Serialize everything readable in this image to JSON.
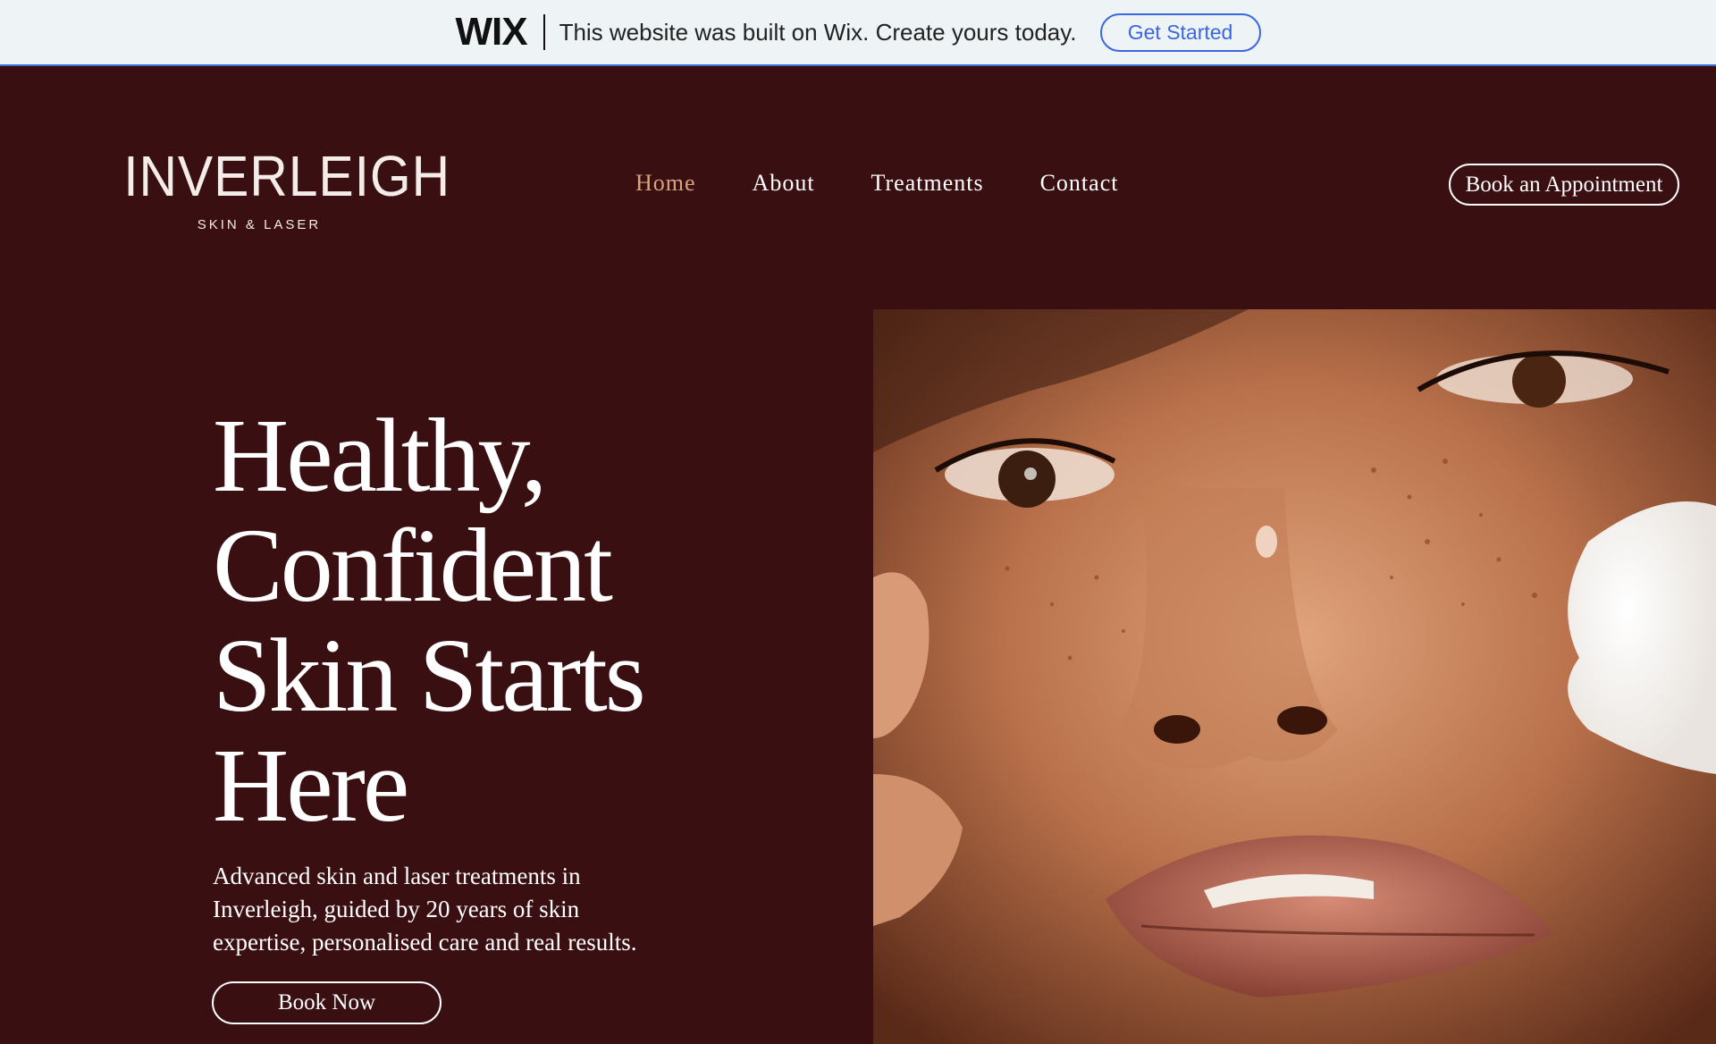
{
  "wix_banner": {
    "logo": "WIX",
    "message": "This website was built on Wix. Create yours today.",
    "cta_label": "Get Started",
    "accent_color": "#3a66e0"
  },
  "header": {
    "logo_main": "INVERLEIGH",
    "logo_sub": "SKIN & LASER",
    "nav": [
      {
        "label": "Home",
        "active": true
      },
      {
        "label": "About",
        "active": false
      },
      {
        "label": "Treatments",
        "active": false
      },
      {
        "label": "Contact",
        "active": false
      }
    ],
    "cta_label": "Book an Appointment",
    "active_color": "#d6a57e"
  },
  "hero": {
    "title_lines": [
      "Healthy,",
      "Confident",
      "Skin Starts",
      "Here"
    ],
    "description": "Advanced skin and laser treatments in Inverleigh, guided by 20 years of skin expertise, personalised care and real results.",
    "cta_label": "Book Now",
    "image_icon": "face-photo-icon"
  },
  "colors": {
    "background": "#3a0f12",
    "text": "#ffffff",
    "banner_background": "#eef3f5"
  }
}
